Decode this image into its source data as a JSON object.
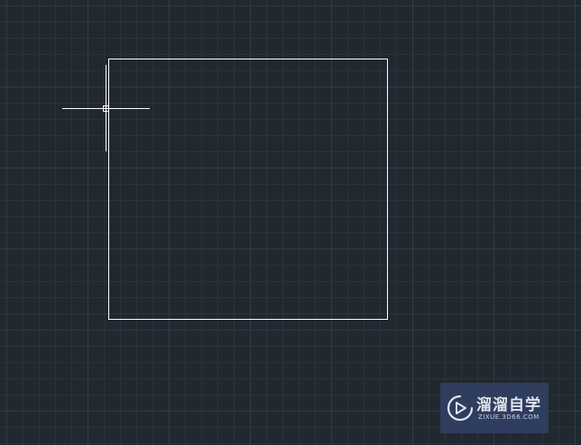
{
  "canvas": {
    "background_color": "#212830",
    "minor_grid_color": "#2a323b",
    "major_grid_color": "#333c46",
    "drawing_color": "#ffffff",
    "crosshair_color": "#ffffff"
  },
  "drawing": {
    "shape": "rectangle",
    "shape_icon": "rectangle-outline"
  },
  "cursor": {
    "icon": "crosshair-pickbox-icon"
  },
  "watermark": {
    "title": "溜溜自学",
    "url": "ZIXUE.3D66.COM",
    "icon": "play-circle-icon",
    "background_color": "#2f3d5e"
  }
}
